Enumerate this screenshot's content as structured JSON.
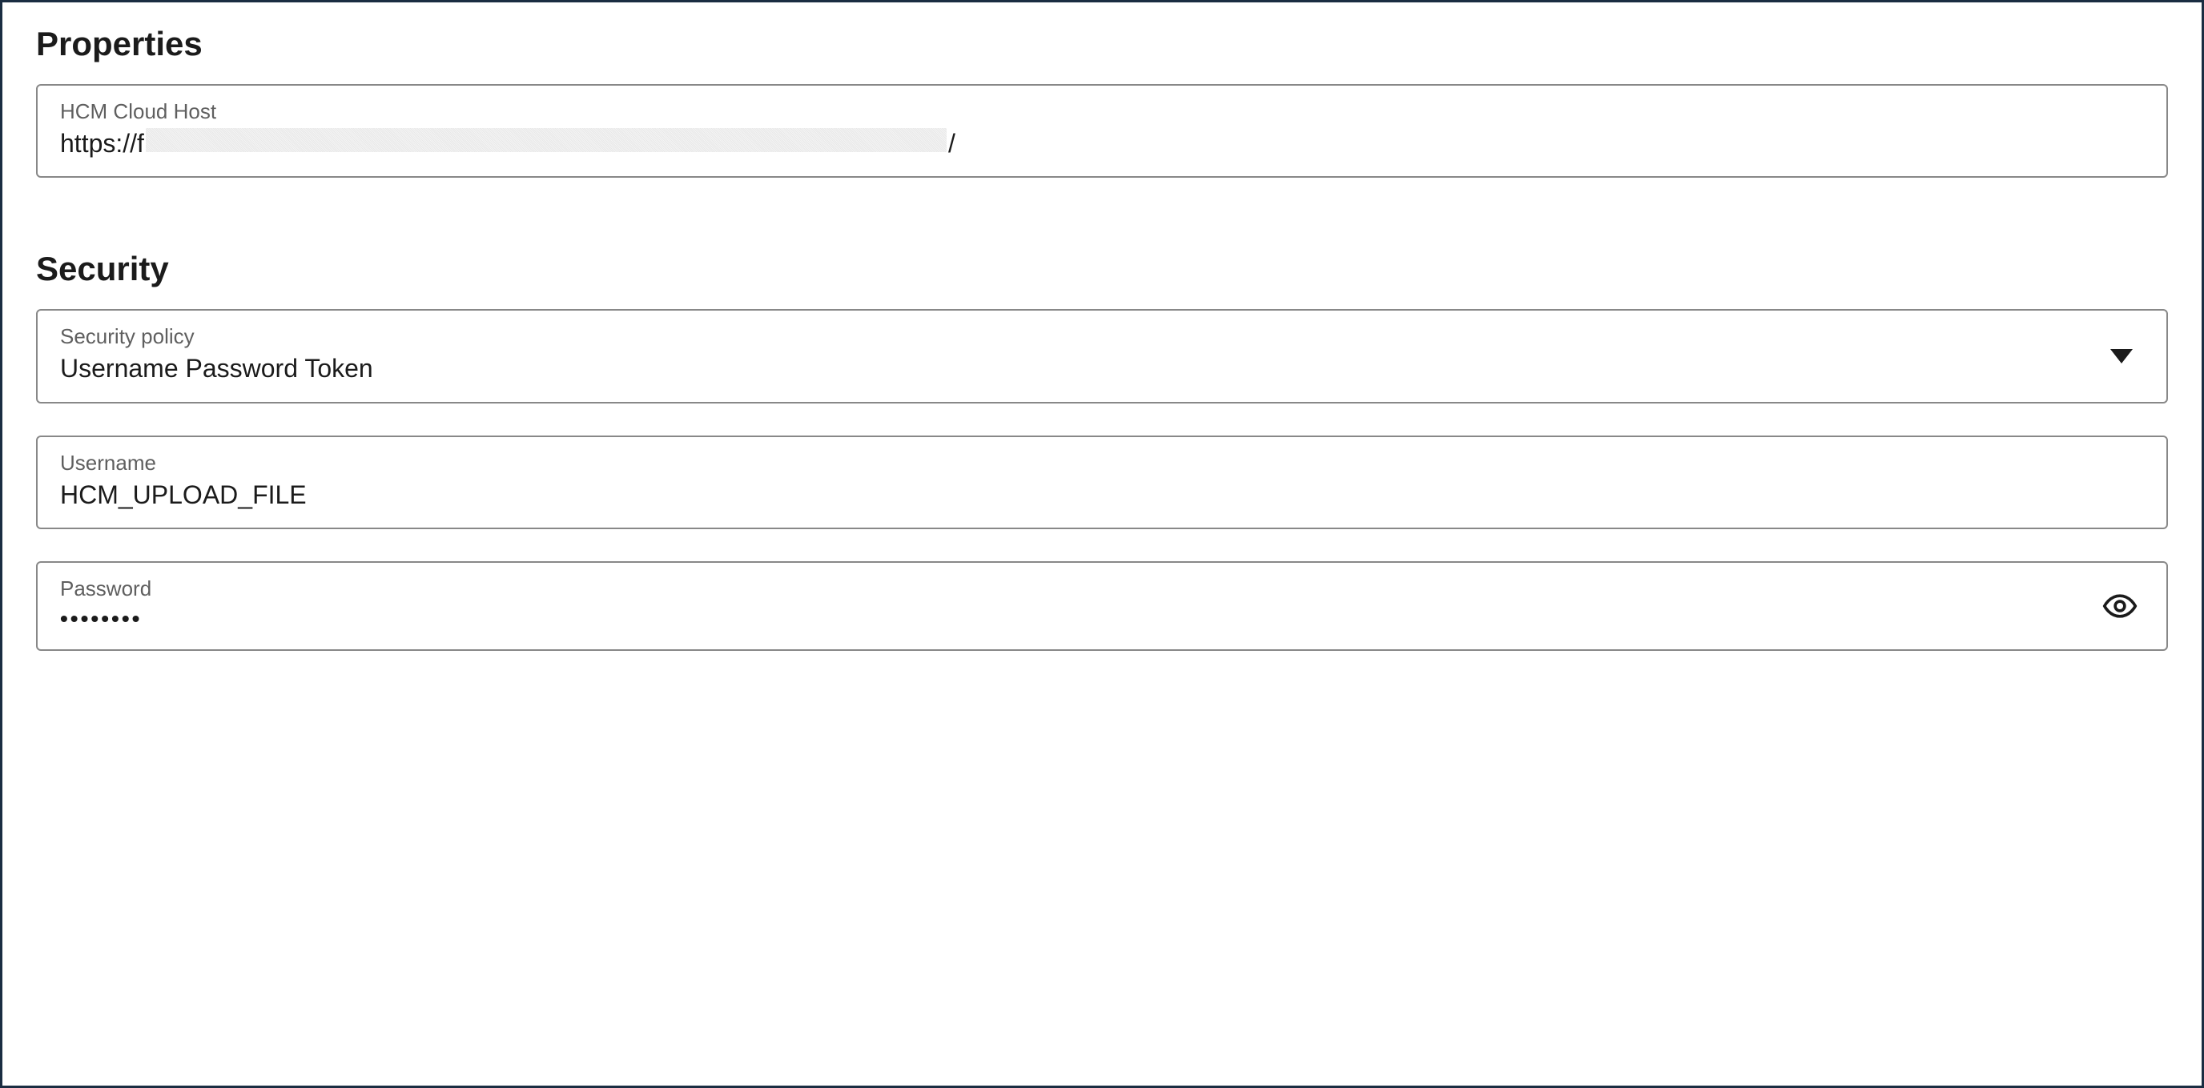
{
  "properties": {
    "heading": "Properties",
    "host": {
      "label": "HCM Cloud Host",
      "value_prefix": "https://f",
      "value_suffix": "/",
      "redacted_url_segment_1": " ",
      "redacted_url_segment_2": " ",
      "redacted_between": ""
    }
  },
  "security": {
    "heading": "Security",
    "policy": {
      "label": "Security policy",
      "value": "Username Password Token"
    },
    "username": {
      "label": "Username",
      "value": "HCM_UPLOAD_FILE"
    },
    "password": {
      "label": "Password",
      "masked_value": "••••••••"
    }
  }
}
